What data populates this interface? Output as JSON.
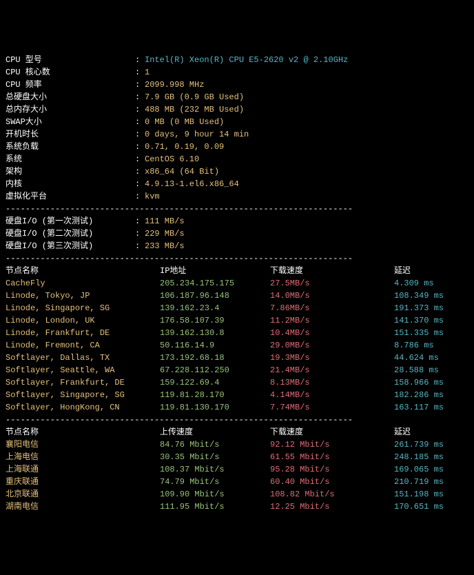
{
  "specs": [
    {
      "label": "CPU 型号",
      "value": "Intel(R) Xeon(R) CPU E5-2620 v2 @ 2.10GHz",
      "vcolor": "cyan"
    },
    {
      "label": "CPU 核心数",
      "value": "1",
      "vcolor": "yellow"
    },
    {
      "label": "CPU 频率",
      "value": "2099.998 MHz",
      "vcolor": "yellow"
    },
    {
      "label": "总硬盘大小",
      "value": "7.9 GB (0.9 GB Used)",
      "vcolor": "yellow"
    },
    {
      "label": "总内存大小",
      "value": "488 MB (232 MB Used)",
      "vcolor": "yellow"
    },
    {
      "label": "SWAP大小",
      "value": "0 MB (0 MB Used)",
      "vcolor": "yellow"
    },
    {
      "label": "开机时长",
      "value": "0 days, 9 hour 14 min",
      "vcolor": "yellow"
    },
    {
      "label": "系统负载",
      "value": "0.71, 0.19, 0.09",
      "vcolor": "yellow"
    },
    {
      "label": "系统",
      "value": "CentOS 6.10",
      "vcolor": "yellow"
    },
    {
      "label": "架构",
      "value": "x86_64 (64 Bit)",
      "vcolor": "yellow"
    },
    {
      "label": "内核",
      "value": "4.9.13-1.el6.x86_64",
      "vcolor": "yellow"
    },
    {
      "label": "虚拟化平台",
      "value": "kvm",
      "vcolor": "yellow"
    }
  ],
  "io_tests": [
    {
      "label": "硬盘I/O (第一次测试)",
      "value": "111 MB/s"
    },
    {
      "label": "硬盘I/O (第二次测试)",
      "value": "229 MB/s"
    },
    {
      "label": "硬盘I/O (第三次测试)",
      "value": "233 MB/s"
    }
  ],
  "net_header": {
    "node": "节点名称",
    "ip": "IP地址",
    "dl": "下载速度",
    "lat": "延迟"
  },
  "net_tests": [
    {
      "node": "CacheFly",
      "ip": "205.234.175.175",
      "dl": "27.5MB/s",
      "lat": "4.309 ms"
    },
    {
      "node": "Linode, Tokyo, JP",
      "ip": "106.187.96.148",
      "dl": "14.0MB/s",
      "lat": "108.349 ms"
    },
    {
      "node": "Linode, Singapore, SG",
      "ip": "139.162.23.4",
      "dl": "7.86MB/s",
      "lat": "191.373 ms"
    },
    {
      "node": "Linode, London, UK",
      "ip": "176.58.107.39",
      "dl": "11.2MB/s",
      "lat": "141.370 ms"
    },
    {
      "node": "Linode, Frankfurt, DE",
      "ip": "139.162.130.8",
      "dl": "10.4MB/s",
      "lat": "151.335 ms"
    },
    {
      "node": "Linode, Fremont, CA",
      "ip": "50.116.14.9",
      "dl": "29.0MB/s",
      "lat": "8.786 ms"
    },
    {
      "node": "Softlayer, Dallas, TX",
      "ip": "173.192.68.18",
      "dl": "19.3MB/s",
      "lat": "44.624 ms"
    },
    {
      "node": "Softlayer, Seattle, WA",
      "ip": "67.228.112.250",
      "dl": "21.4MB/s",
      "lat": "28.588 ms"
    },
    {
      "node": "Softlayer, Frankfurt, DE",
      "ip": "159.122.69.4",
      "dl": "8.13MB/s",
      "lat": "158.966 ms"
    },
    {
      "node": "Softlayer, Singapore, SG",
      "ip": "119.81.28.170",
      "dl": "4.14MB/s",
      "lat": "182.286 ms"
    },
    {
      "node": "Softlayer, HongKong, CN",
      "ip": "119.81.130.170",
      "dl": "7.74MB/s",
      "lat": "163.117 ms"
    }
  ],
  "cn_header": {
    "node": "节点名称",
    "ul": "上传速度",
    "dl": "下载速度",
    "lat": "延迟"
  },
  "cn_tests": [
    {
      "node": "襄阳电信",
      "ul": "84.76 Mbit/s",
      "dl": "92.12 Mbit/s",
      "lat": "261.739 ms"
    },
    {
      "node": "上海电信",
      "ul": "30.35 Mbit/s",
      "dl": "61.55 Mbit/s",
      "lat": "248.185 ms"
    },
    {
      "node": "上海联通",
      "ul": "108.37 Mbit/s",
      "dl": "95.28 Mbit/s",
      "lat": "169.065 ms"
    },
    {
      "node": "重庆联通",
      "ul": "74.79 Mbit/s",
      "dl": "60.40 Mbit/s",
      "lat": "210.719 ms"
    },
    {
      "node": "北京联通",
      "ul": "109.90 Mbit/s",
      "dl": "108.82 Mbit/s",
      "lat": "151.198 ms"
    },
    {
      "node": "湖南电信",
      "ul": "111.95 Mbit/s",
      "dl": "12.25 Mbit/s",
      "lat": "170.651 ms"
    }
  ],
  "divider": "----------------------------------------------------------------------"
}
